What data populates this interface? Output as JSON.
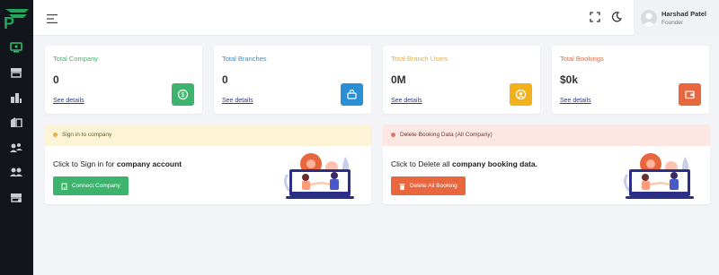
{
  "header": {
    "user_name": "Harshad Patel",
    "user_role": "Founder"
  },
  "sidebar": {
    "logo_letter": "P",
    "items": [
      "dashboard-icon",
      "store-icon",
      "buildings-icon",
      "factory-icon",
      "users-add-icon",
      "users-group-icon",
      "booking-icon"
    ]
  },
  "stats": [
    {
      "title": "Total Company",
      "value": "0",
      "link": "See details",
      "color": "#3db46d",
      "icon": "dollar-icon"
    },
    {
      "title": "Total Branches",
      "value": "0",
      "link": "See details",
      "color": "#2b8fd6",
      "icon": "bag-icon"
    },
    {
      "title": "Total Branch Users",
      "value": "0M",
      "link": "See details",
      "color": "#f2b01a",
      "icon": "user-circle-icon"
    },
    {
      "title": "Total Bookings",
      "value": "$0k",
      "link": "See details",
      "color": "#e9673f",
      "icon": "wallet-icon"
    }
  ],
  "actions": [
    {
      "header": "Sign in to company",
      "text_prefix": "Click to Sign in for ",
      "text_bold": "company account",
      "button": "Connect Company",
      "header_bg": "#fdf4d8",
      "header_color": "#6b5a1e",
      "button_color": "#3db46d"
    },
    {
      "header": "Delete Booking Data (All Company)",
      "text_prefix": "Click to Delete all ",
      "text_bold": "company booking data.",
      "button": "Delete All Booking",
      "header_bg": "#fde7e3",
      "header_color": "#6e3a33",
      "button_color": "#e9673f"
    }
  ]
}
